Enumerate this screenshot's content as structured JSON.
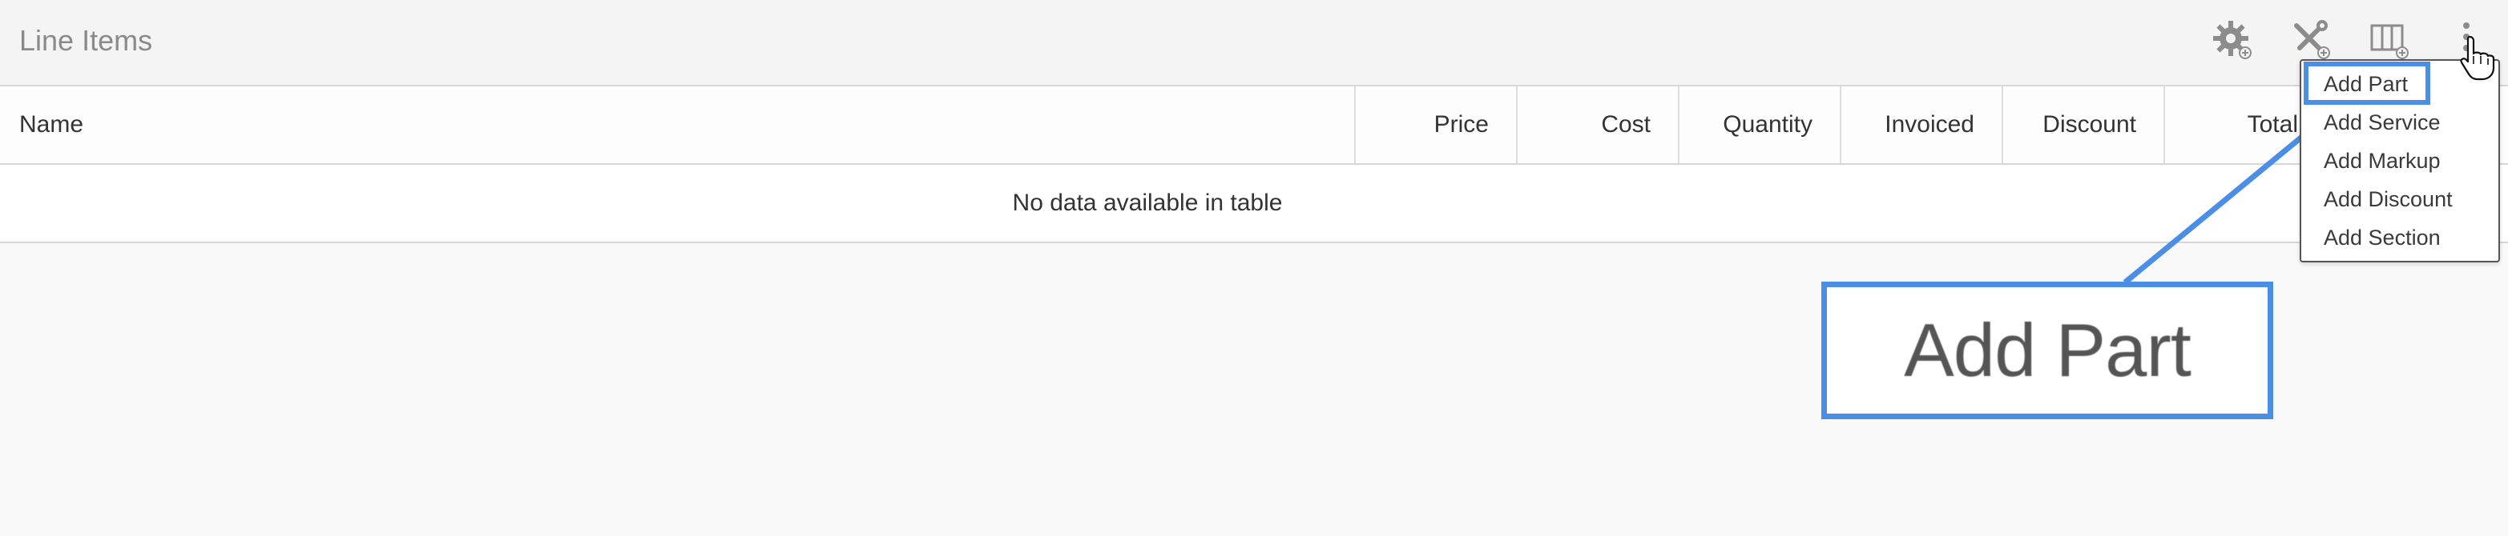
{
  "header": {
    "title": "Line Items",
    "icons": [
      "gear-add-icon",
      "tools-add-icon",
      "columns-add-icon",
      "more-vertical-icon"
    ]
  },
  "table": {
    "columns": [
      "Name",
      "Price",
      "Cost",
      "Quantity",
      "Invoiced",
      "Discount",
      "Total"
    ],
    "empty_message": "No data available in table"
  },
  "dropdown": {
    "items": [
      "Add Part",
      "Add Service",
      "Add Markup",
      "Add Discount",
      "Add Section"
    ]
  },
  "callout": {
    "text": "Add Part"
  },
  "colors": {
    "accent": "#4a8ee6",
    "header_bg": "#f4f4f4",
    "page_bg": "#f9f9f9"
  }
}
